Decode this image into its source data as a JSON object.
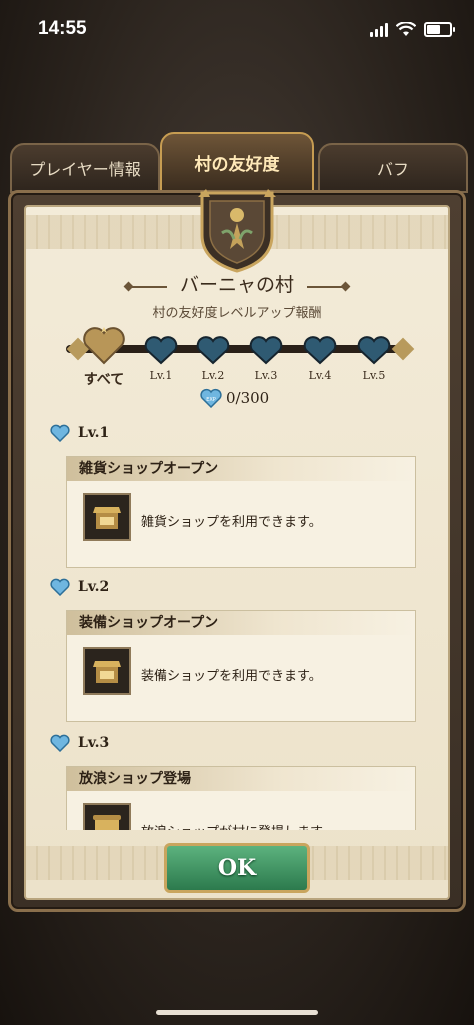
{
  "status_bar": {
    "time": "14:55",
    "icons": [
      "signal-icon",
      "wifi-icon",
      "battery-icon"
    ]
  },
  "tabs": [
    {
      "label": "プレイヤー情報",
      "active": false
    },
    {
      "label": "村の友好度",
      "active": true
    },
    {
      "label": "バフ",
      "active": false
    }
  ],
  "header": {
    "village_name": "バーニャの村",
    "subtitle": "村の友好度レベルアップ報酬"
  },
  "levels": [
    {
      "label": "すべて",
      "selected": true
    },
    {
      "label": "Lv.1"
    },
    {
      "label": "Lv.2"
    },
    {
      "label": "Lv.3"
    },
    {
      "label": "Lv.4"
    },
    {
      "label": "Lv.5"
    }
  ],
  "exp": {
    "badge": "EXP",
    "value": "0/300"
  },
  "rewards": [
    {
      "level": "Lv.1",
      "title": "雑貨ショップオープン",
      "desc": "雑貨ショップを利用できます。"
    },
    {
      "level": "Lv.2",
      "title": "装備ショップオープン",
      "desc": "装備ショップを利用できます。"
    },
    {
      "level": "Lv.3",
      "title": "放浪ショップ登場",
      "desc": "放浪ショップが村に登場します。"
    }
  ],
  "ok_button": {
    "label": "OK"
  },
  "colors": {
    "accent_green": "#3e9463",
    "heart_blue": "#2f5a72",
    "heart_gold": "#c9a55e",
    "paper": "#efe6d0"
  }
}
